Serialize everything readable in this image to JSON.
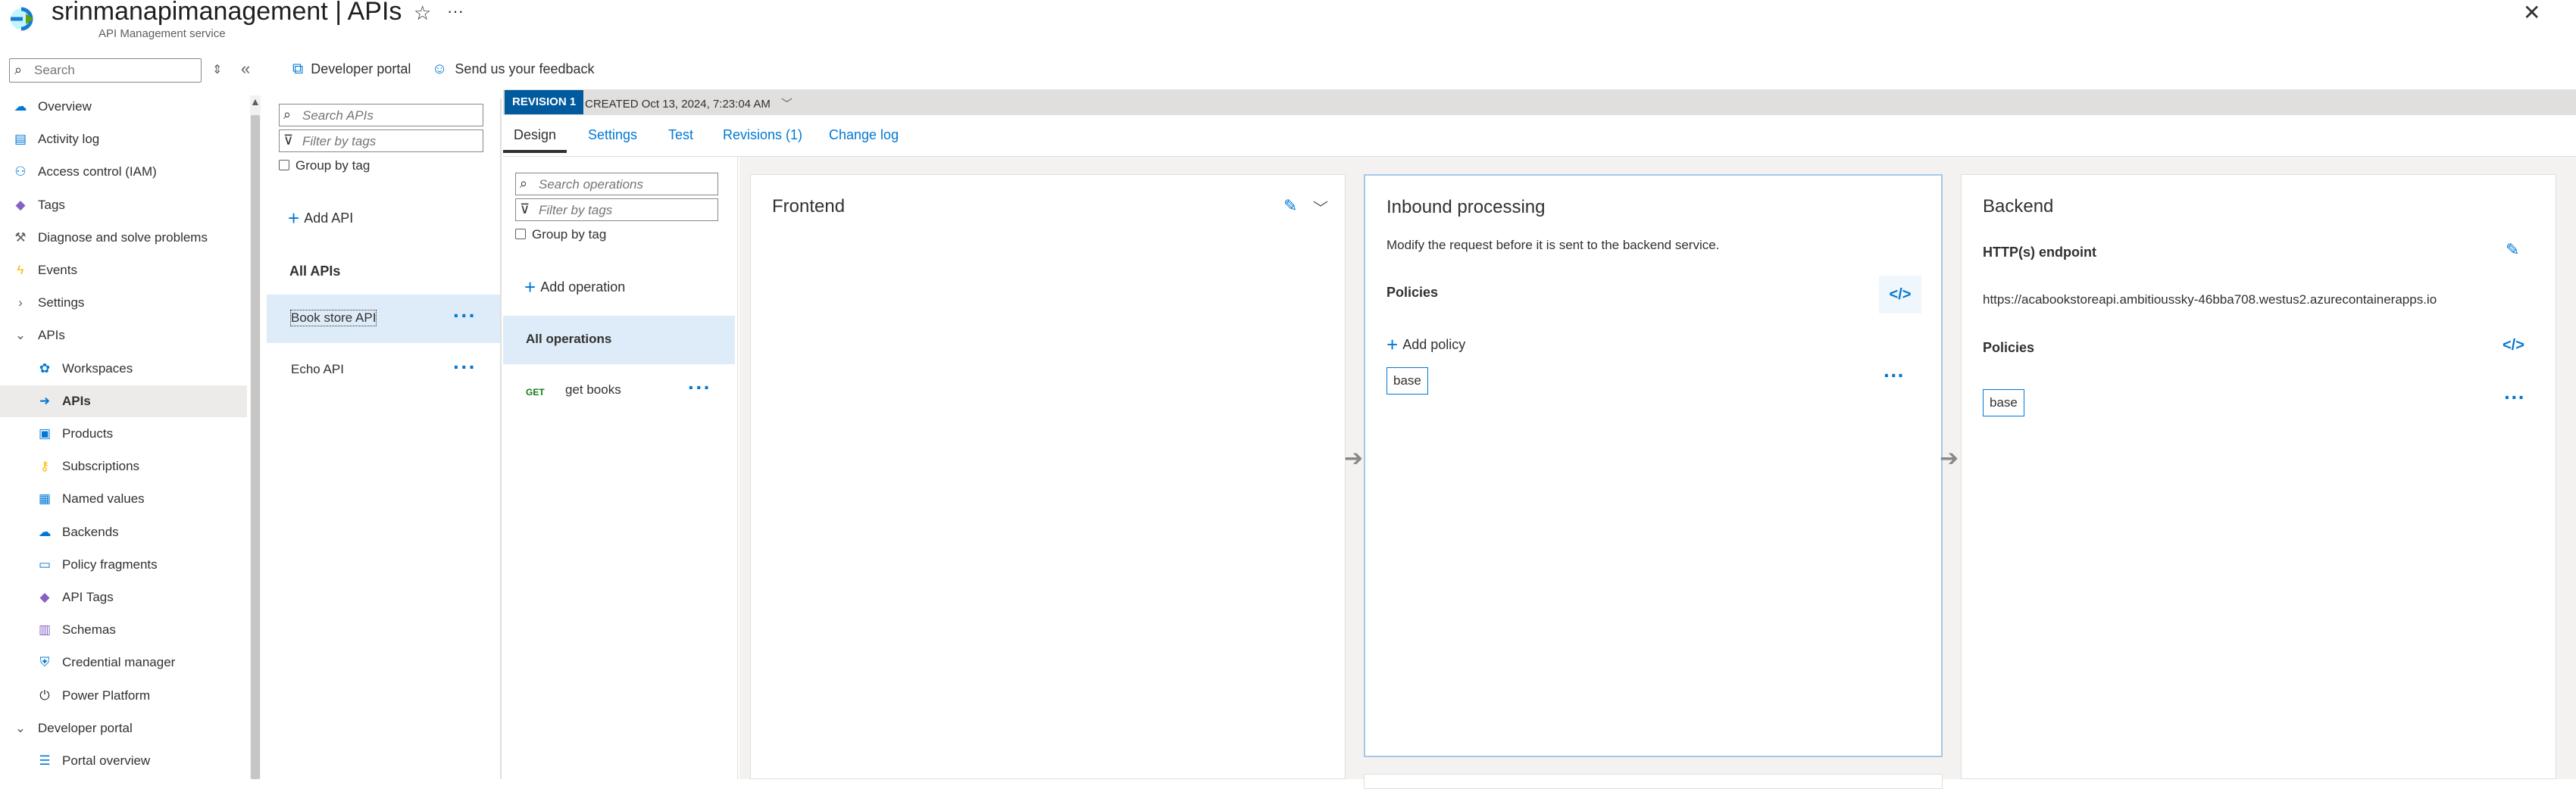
{
  "header": {
    "title": "srinmanapimanagement | APIs",
    "subtitle": "API Management service"
  },
  "nav": {
    "search_placeholder": "Search",
    "items": [
      {
        "label": "Overview",
        "icon": "cloud-icon",
        "color": "#0078d4"
      },
      {
        "label": "Activity log",
        "icon": "log-icon",
        "color": "#0078d4"
      },
      {
        "label": "Access control (IAM)",
        "icon": "people-icon",
        "color": "#0078d4"
      },
      {
        "label": "Tags",
        "icon": "tag-icon",
        "color": "#8661c5"
      },
      {
        "label": "Diagnose and solve problems",
        "icon": "wrench-icon",
        "color": "#605e5c"
      },
      {
        "label": "Events",
        "icon": "lightning-icon",
        "color": "#ffb900"
      },
      {
        "label": "Settings",
        "icon": "chevron-right-icon",
        "color": "#605e5c"
      },
      {
        "label": "APIs",
        "icon": "chevron-down-icon",
        "color": "#605e5c"
      },
      {
        "label": "Workspaces",
        "icon": "workspace-icon",
        "color": "#0078d4"
      },
      {
        "label": "APIs",
        "icon": "api-icon",
        "color": "#0078d4"
      },
      {
        "label": "Products",
        "icon": "products-icon",
        "color": "#0078d4"
      },
      {
        "label": "Subscriptions",
        "icon": "key-icon",
        "color": "#ffb900"
      },
      {
        "label": "Named values",
        "icon": "grid-icon",
        "color": "#0078d4"
      },
      {
        "label": "Backends",
        "icon": "backend-cloud-icon",
        "color": "#0078d4"
      },
      {
        "label": "Policy fragments",
        "icon": "document-icon",
        "color": "#0078d4"
      },
      {
        "label": "API Tags",
        "icon": "tag-icon",
        "color": "#8661c5"
      },
      {
        "label": "Schemas",
        "icon": "schema-icon",
        "color": "#8661c5"
      },
      {
        "label": "Credential manager",
        "icon": "shield-icon",
        "color": "#0078d4"
      },
      {
        "label": "Power Platform",
        "icon": "plug-icon",
        "color": "#323130"
      },
      {
        "label": "Developer portal",
        "icon": "chevron-down-icon",
        "color": "#605e5c"
      },
      {
        "label": "Portal overview",
        "icon": "list-icon",
        "color": "#0078d4"
      }
    ],
    "selected_index": 9
  },
  "toolbar": {
    "developer_portal": "Developer portal",
    "feedback": "Send us your feedback"
  },
  "api_list": {
    "search_placeholder": "Search APIs",
    "filter_placeholder": "Filter by tags",
    "group_by": "Group by tag",
    "add_api": "Add API",
    "section_title": "All APIs",
    "apis": [
      {
        "name": "Book store API"
      },
      {
        "name": "Echo API"
      }
    ]
  },
  "revision": {
    "badge": "REVISION 1",
    "created": "CREATED Oct 13, 2024, 7:23:04 AM"
  },
  "tabs": [
    "Design",
    "Settings",
    "Test",
    "Revisions (1)",
    "Change log"
  ],
  "operations": {
    "search_placeholder": "Search operations",
    "filter_placeholder": "Filter by tags",
    "group_by": "Group by tag",
    "add_operation": "Add operation",
    "all_operations": "All operations",
    "items": [
      {
        "method": "GET",
        "name": "get books"
      }
    ]
  },
  "frontend": {
    "title": "Frontend"
  },
  "inbound": {
    "title": "Inbound processing",
    "description": "Modify the request before it is sent to the backend service.",
    "policies_label": "Policies",
    "add_policy": "Add policy",
    "base_tag": "base"
  },
  "backend": {
    "title": "Backend",
    "endpoint_label": "HTTP(s) endpoint",
    "endpoint_url": "https://acabookstoreapi.ambitioussky-46bba708.westus2.azurecontainerapps.io",
    "policies_label": "Policies",
    "base_tag": "base"
  }
}
